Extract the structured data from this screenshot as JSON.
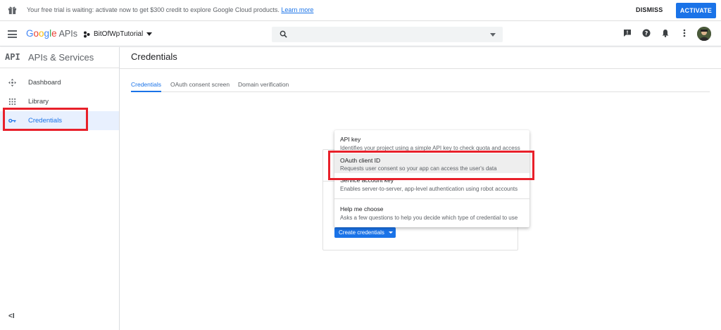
{
  "banner": {
    "message": "Your free trial is waiting: activate now to get $300 credit to explore Google Cloud products.",
    "learn_more": "Learn more",
    "dismiss": "DISMISS",
    "activate": "ACTIVATE"
  },
  "header": {
    "logo_google": [
      "G",
      "o",
      "o",
      "g",
      "l",
      "e"
    ],
    "logo_apis": "APIs",
    "project": "BitOfWpTutorial",
    "search_placeholder": ""
  },
  "sidebar": {
    "api_badge": "API",
    "title": "APIs & Services",
    "items": [
      {
        "label": "Dashboard",
        "icon": "dashboard-icon"
      },
      {
        "label": "Library",
        "icon": "library-icon"
      },
      {
        "label": "Credentials",
        "icon": "key-icon",
        "active": true
      }
    ],
    "collapse_label": "<I"
  },
  "main": {
    "title": "Credentials",
    "tabs": [
      {
        "label": "Credentials",
        "active": true
      },
      {
        "label": "OAuth consent screen"
      },
      {
        "label": "Domain verification"
      }
    ],
    "create_button": "Create credentials"
  },
  "menu": {
    "items": [
      {
        "title": "API key",
        "desc": "Identifies your project using a simple API key to check quota and access"
      },
      {
        "title": "OAuth client ID",
        "desc": "Requests user consent so your app can access the user's data",
        "highlighted": true
      },
      {
        "title": "Service account key",
        "desc": "Enables server-to-server, app-level authentication using robot accounts"
      },
      {
        "title": "Help me choose",
        "desc": "Asks a few questions to help you decide which type of credential to use"
      }
    ]
  },
  "colors": {
    "accent": "#1a73e8",
    "annotation_red": "#e8202a"
  }
}
